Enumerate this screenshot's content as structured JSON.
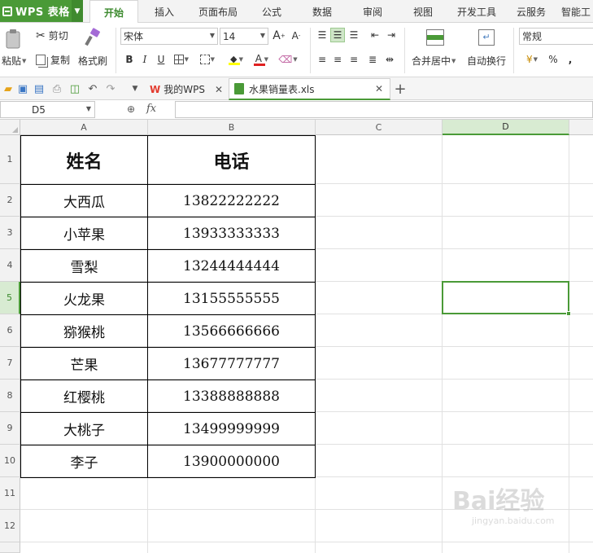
{
  "app": {
    "name": "WPS 表格"
  },
  "menu_tabs": [
    "开始",
    "插入",
    "页面布局",
    "公式",
    "数据",
    "审阅",
    "视图",
    "开发工具",
    "云服务",
    "智能工"
  ],
  "active_menu_tab": "开始",
  "ribbon": {
    "paste": "粘贴",
    "cut": "剪切",
    "copy": "复制",
    "format_painter": "格式刷",
    "font_name": "宋体",
    "font_size": "14",
    "bold": "B",
    "italic": "I",
    "underline": "U",
    "merge_center": "合并居中",
    "wrap_text": "自动换行",
    "number_format": "常规",
    "percent": "%"
  },
  "doc_tabs": [
    {
      "label": "我的WPS",
      "active": false
    },
    {
      "label": "水果销量表.xls",
      "active": true
    }
  ],
  "formula_bar": {
    "name_box": "D5",
    "fx": "fx",
    "content": ""
  },
  "columns": [
    "A",
    "B",
    "C",
    "D"
  ],
  "selected_column": "D",
  "rows": [
    "1",
    "2",
    "3",
    "4",
    "5",
    "6",
    "7",
    "8",
    "9",
    "10",
    "11",
    "12"
  ],
  "selected_row": "5",
  "table": {
    "headers": [
      "姓名",
      "电话"
    ],
    "rows": [
      [
        "大西瓜",
        "13822222222"
      ],
      [
        "小苹果",
        "13933333333"
      ],
      [
        "雪梨",
        "13244444444"
      ],
      [
        "火龙果",
        "13155555555"
      ],
      [
        "猕猴桃",
        "13566666666"
      ],
      [
        "芒果",
        "13677777777"
      ],
      [
        "红樱桃",
        "13388888888"
      ],
      [
        "大桃子",
        "13499999999"
      ],
      [
        "李子",
        "13900000000"
      ]
    ]
  },
  "watermark": {
    "text": "Bai经验",
    "url": "jingyan.baidu.com"
  },
  "colors": {
    "accent": "#4a9a37",
    "selected_header": "#d8ebd2",
    "grid": "#e1e1e1"
  }
}
